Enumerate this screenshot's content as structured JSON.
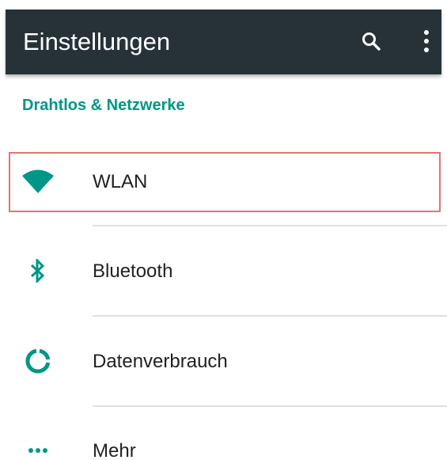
{
  "toolbar": {
    "title": "Einstellungen",
    "search_icon": "search-icon",
    "overflow_icon": "more-vert-icon"
  },
  "category": {
    "label": "Drahtlos & Netzwerke"
  },
  "items": [
    {
      "label": "WLAN",
      "icon": "wifi-icon",
      "highlighted": true
    },
    {
      "label": "Bluetooth",
      "icon": "bluetooth-icon"
    },
    {
      "label": "Datenverbrauch",
      "icon": "data-usage-icon"
    },
    {
      "label": "Mehr",
      "icon": "more-horiz-icon"
    }
  ],
  "colors": {
    "toolbar_bg": "#263238",
    "accent": "#009688",
    "highlight_border": "#e57373",
    "text_primary": "#212121",
    "divider": "#e0e0e0"
  }
}
